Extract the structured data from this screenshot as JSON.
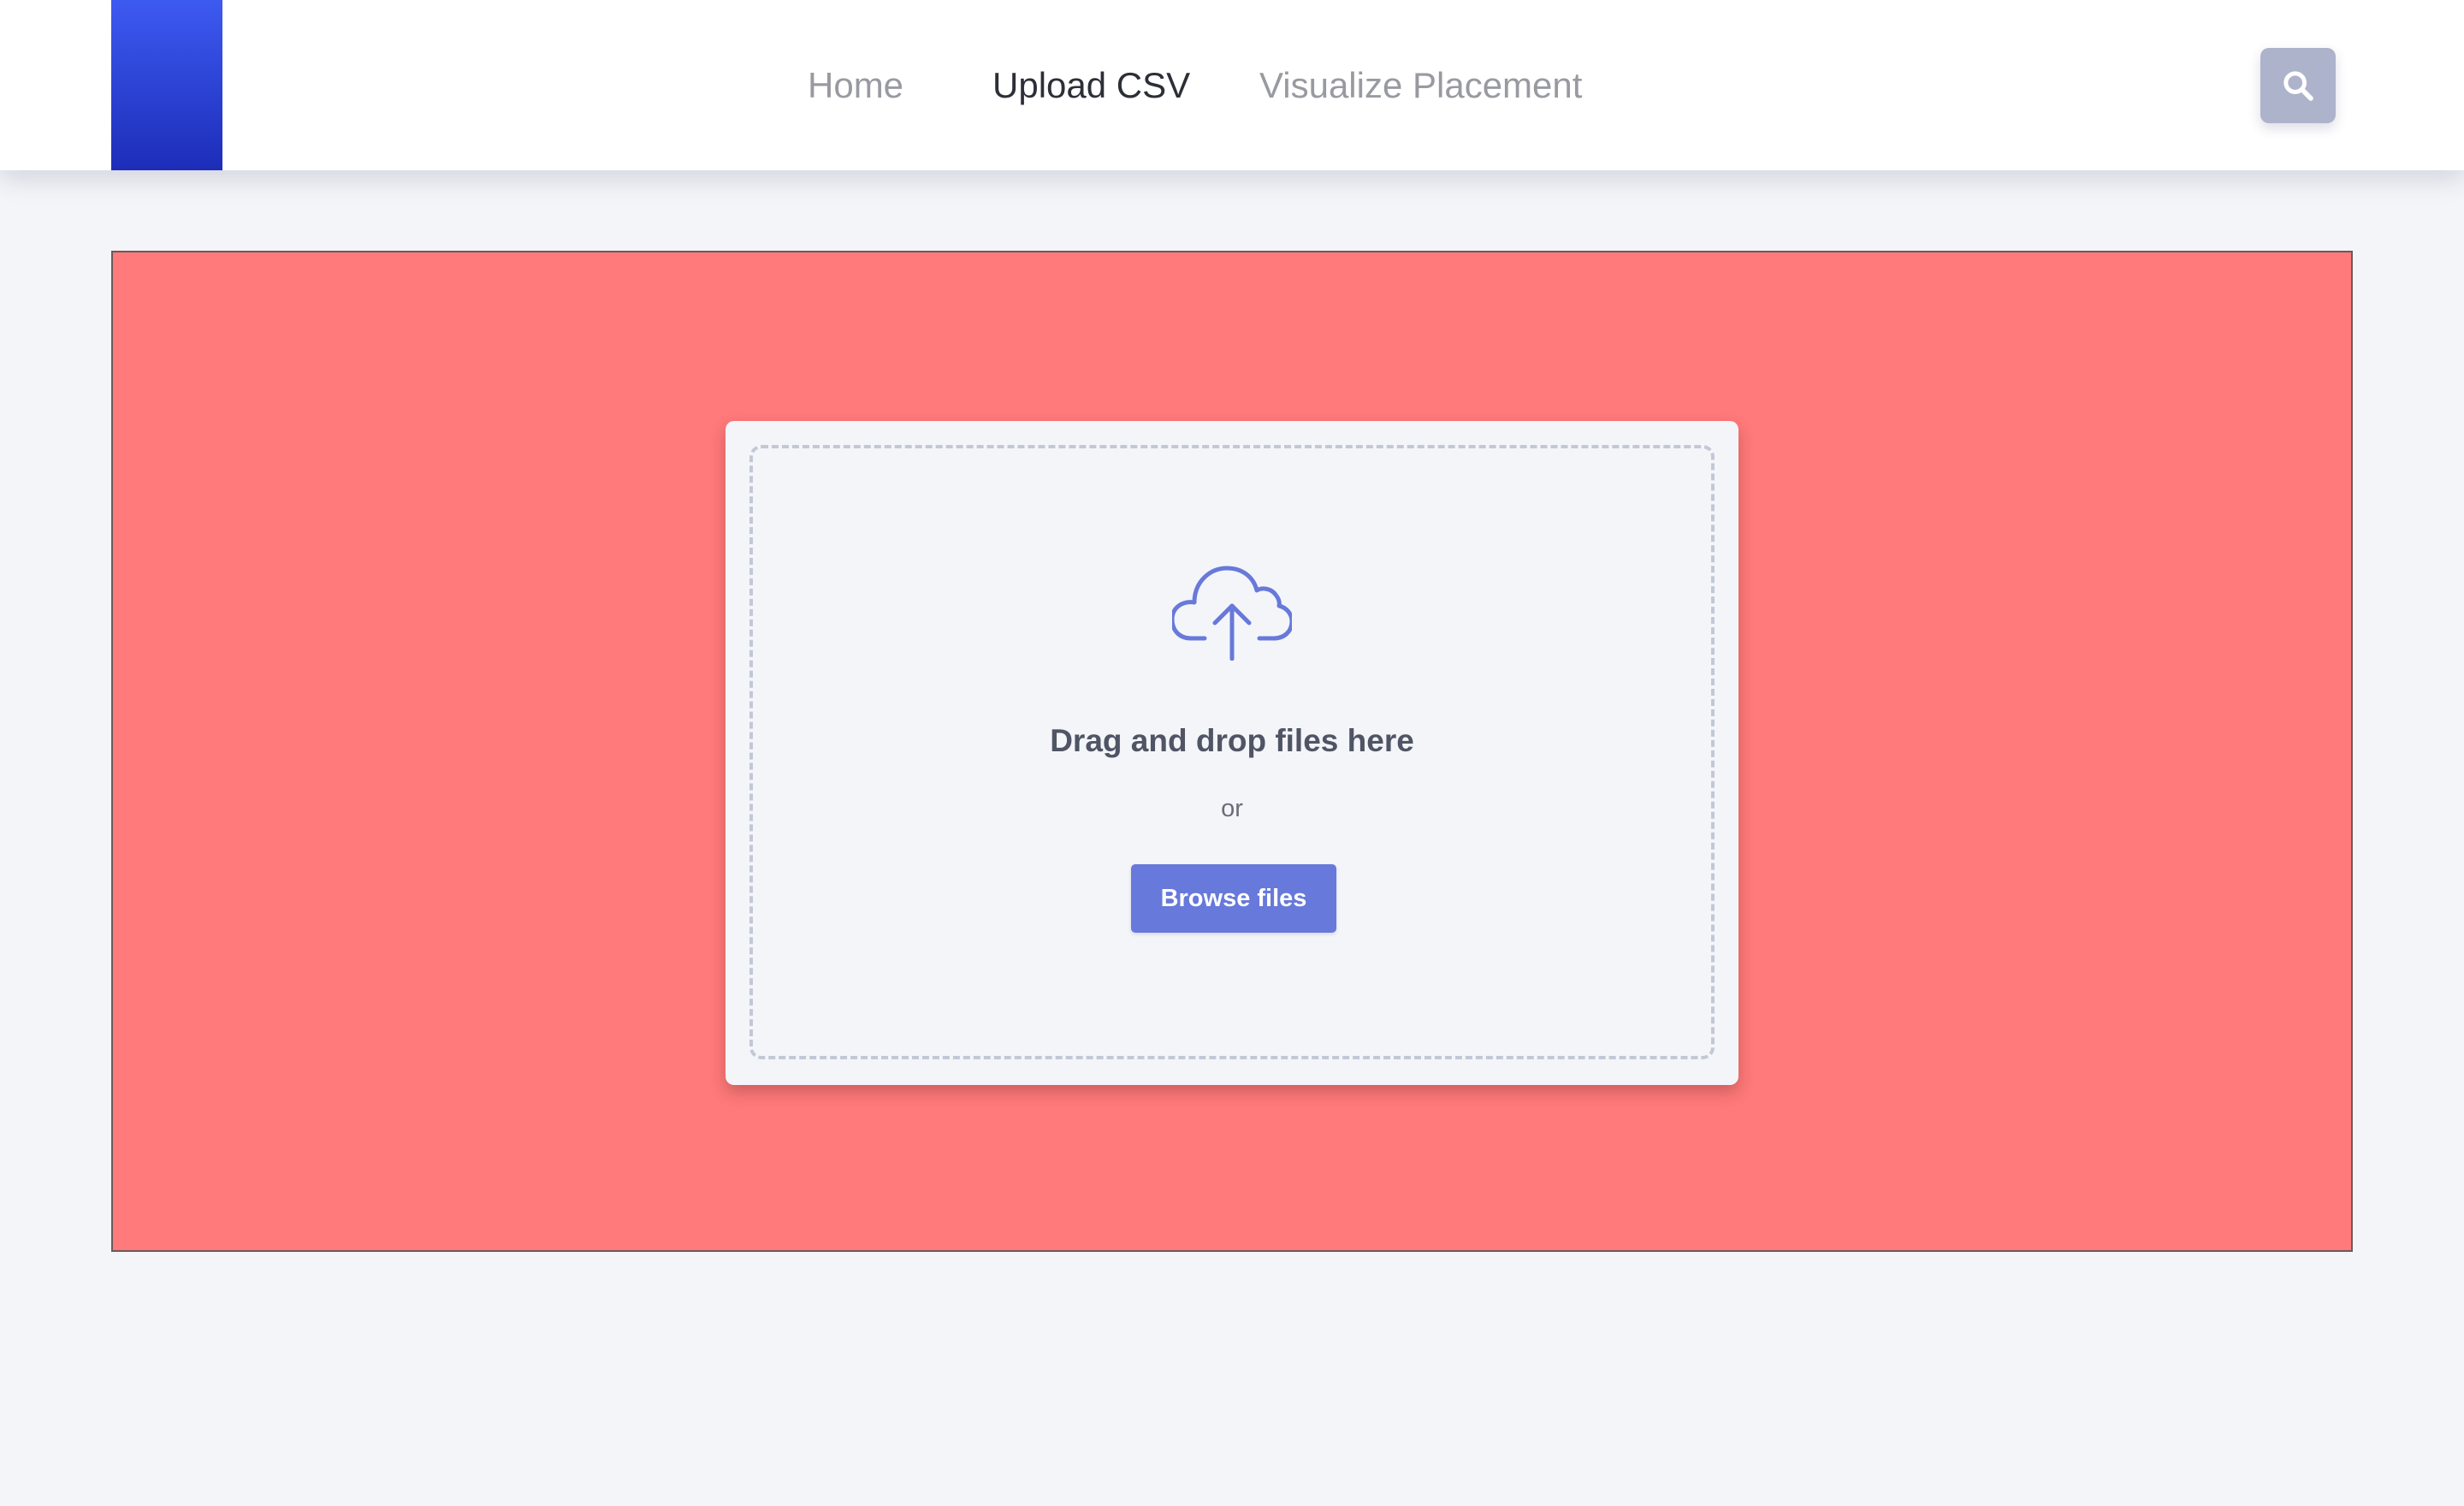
{
  "header": {
    "nav": [
      {
        "label": "Home",
        "active": false
      },
      {
        "label": "Upload CSV",
        "active": true
      },
      {
        "label": "Visualize Placement",
        "active": false
      }
    ],
    "search_icon": "search-icon"
  },
  "upload": {
    "icon": "cloud-upload-icon",
    "title": "Drag and drop files here",
    "separator": "or",
    "browse_label": "Browse files"
  },
  "colors": {
    "logo_top": "#3d5af1",
    "logo_bottom": "#1c2db8",
    "stage_background": "#ff7a7a",
    "page_background": "#f4f5f9",
    "accent": "#6779da",
    "search_button": "#aeb3cc"
  }
}
